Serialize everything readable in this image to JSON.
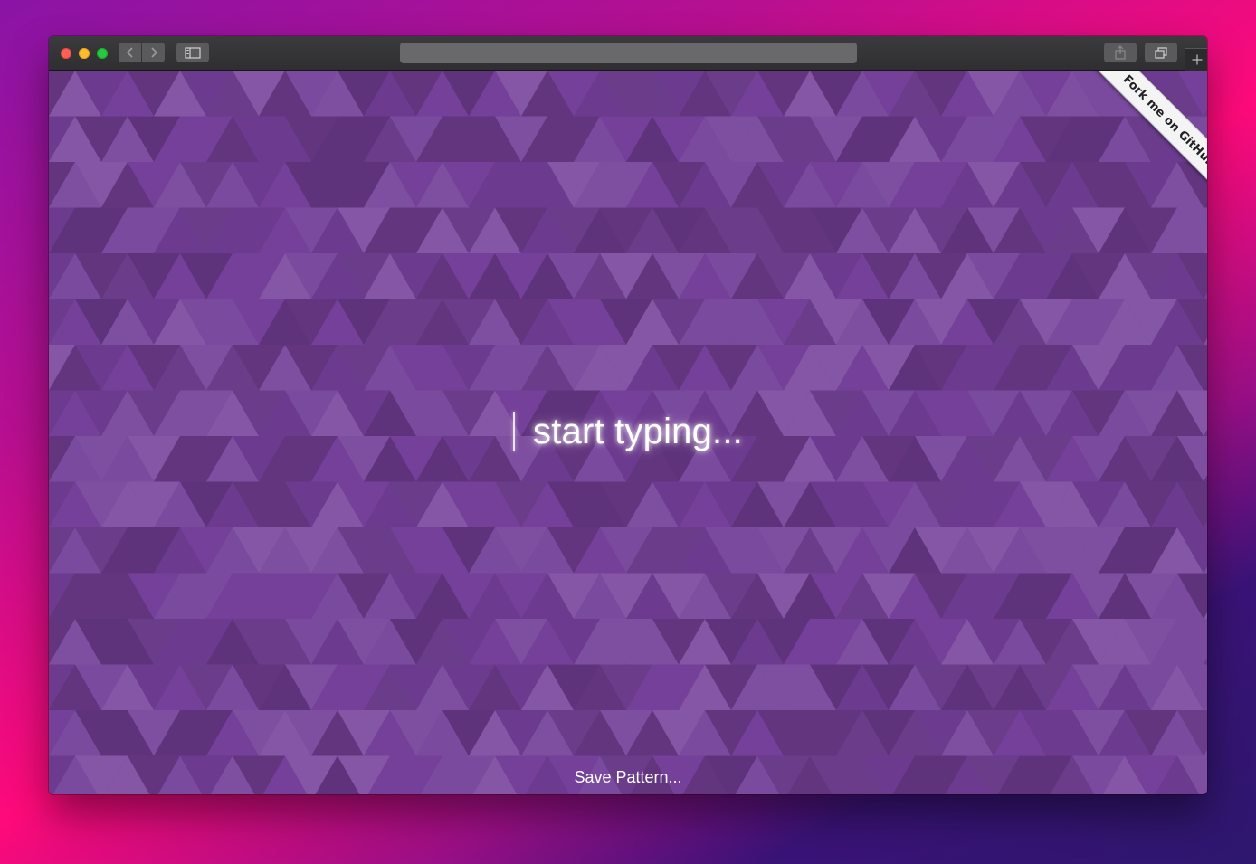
{
  "browser": {
    "address_text": "",
    "colors": {
      "toolbar": "#353537",
      "traffic_red": "#fe5f57",
      "traffic_yellow": "#febc2e",
      "traffic_green": "#28c840"
    },
    "icons": [
      "back-arrow-icon",
      "forward-arrow-icon",
      "sidebar-icon",
      "share-icon",
      "tabs-icon",
      "plus-icon"
    ]
  },
  "page": {
    "prompt_text": "start typing...",
    "save_label": "Save Pattern...",
    "ribbon_label": "Fork me on GitHub",
    "pattern_colors": [
      "#6c3a8e",
      "#74409a",
      "#7a4a9e",
      "#63357f",
      "#8556a6",
      "#5f337c",
      "#7e4fa0",
      "#6a3c8a"
    ]
  }
}
